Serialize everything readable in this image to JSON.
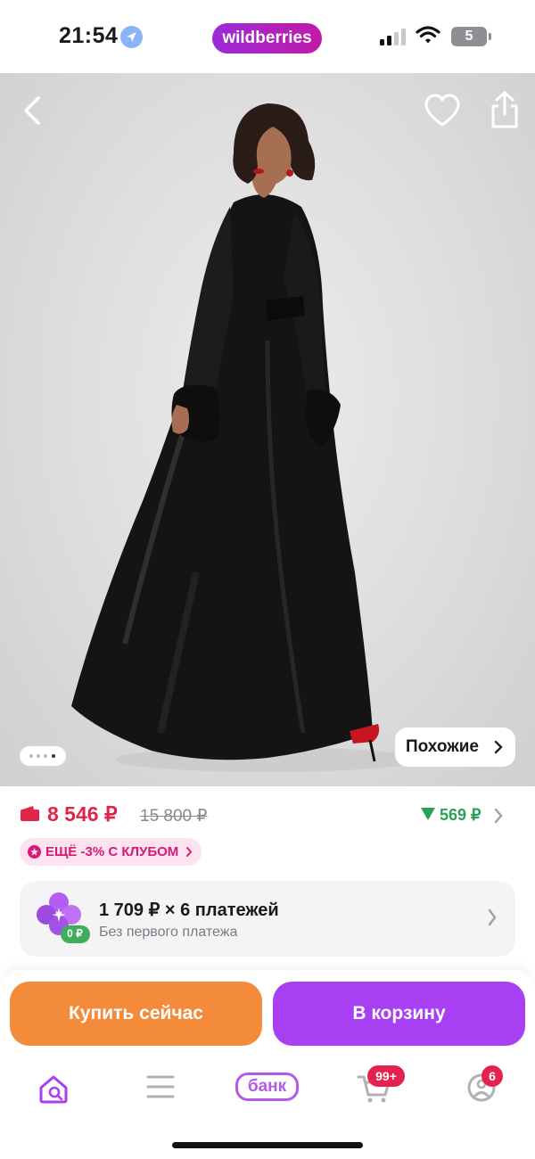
{
  "status_bar": {
    "time": "21:54",
    "brand": "wildberries",
    "battery_level": "5"
  },
  "hero": {
    "image_alt": "black satin robe dress with feather cuffs",
    "gallery_total": 4,
    "gallery_active": 4,
    "similar_label": "Похожие"
  },
  "price": {
    "current": "8 546 ₽",
    "old": "15 800 ₽",
    "cashback": "569 ₽",
    "club_offer": "ЕЩЁ -3% С КЛУБОМ"
  },
  "installments": {
    "badge": "0 ₽",
    "main": "1 709 ₽ × 6 платежей",
    "sub": "Без первого платежа"
  },
  "actions": {
    "buy_now": "Купить сейчас",
    "add_to_cart": "В корзину"
  },
  "tabbar": {
    "bank_label": "банк",
    "cart_badge": "99+",
    "profile_badge": "6"
  },
  "colors": {
    "brand_gradient_start": "#9b2bd6",
    "brand_gradient_end": "#c21aa8",
    "price": "#e0254a",
    "cashback": "#2aa15a",
    "buy_now": "#f48b3a",
    "add_to_cart": "#a93ff2",
    "badge": "#e5224f"
  },
  "icons": [
    "location-arrow-icon",
    "signal-icon",
    "wifi-icon",
    "battery-icon",
    "back-arrow-icon",
    "heart-icon",
    "share-icon",
    "chevron-right-icon",
    "wallet-icon",
    "arrow-down-icon",
    "club-star-icon",
    "clover-icon",
    "home-search-icon",
    "catalog-icon",
    "cart-icon",
    "profile-icon"
  ]
}
